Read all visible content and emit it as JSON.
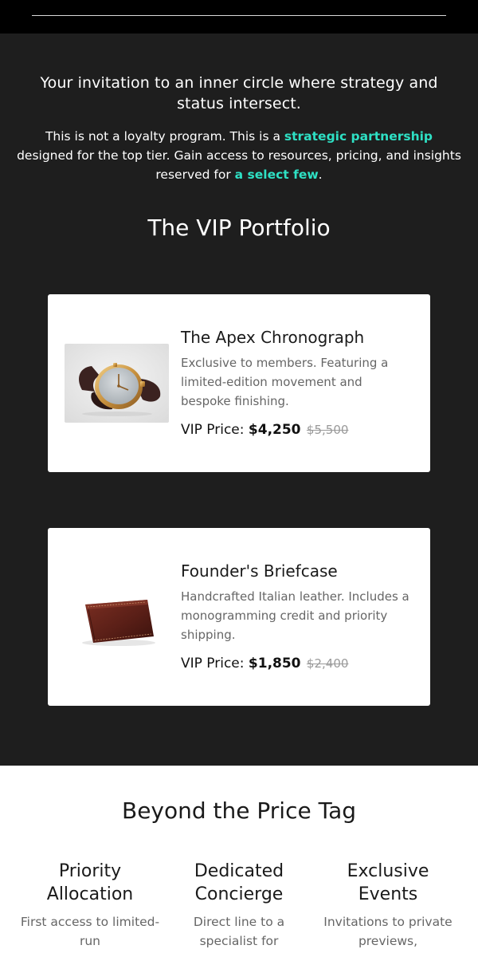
{
  "intro": {
    "title": "Your invitation to an inner circle where strategy and status intersect.",
    "body_part1": "This is not a loyalty program. This is a ",
    "highlight1": "strategic partnership",
    "body_part2": " designed for the top tier. Gain access to resources, pricing, and insights reserved for ",
    "highlight2": "a select few",
    "body_part3": "."
  },
  "portfolio": {
    "title": "The VIP Portfolio",
    "products": [
      {
        "name": "The Apex Chronograph",
        "description": "Exclusive to members. Featuring a limited-edition movement and bespoke finishing.",
        "price_label": "VIP Price:",
        "price": "$4,250",
        "original_price": "$5,500",
        "image": "watch-image"
      },
      {
        "name": "Founder's Briefcase",
        "description": "Handcrafted Italian leather. Includes a monogramming credit and priority shipping.",
        "price_label": "VIP Price:",
        "price": "$1,850",
        "original_price": "$2,400",
        "image": "leather-wallet-image"
      }
    ]
  },
  "beyond": {
    "title": "Beyond the Price Tag",
    "benefits": [
      {
        "title": "Priority Allocation",
        "description": "First access to limited-run"
      },
      {
        "title": "Dedicated Concierge",
        "description": "Direct line to a specialist for"
      },
      {
        "title": "Exclusive Events",
        "description": "Invitations to private previews,"
      }
    ]
  },
  "colors": {
    "accent": "#2ee0c4",
    "dark_background": "#1e1e1e",
    "header_background": "#000000"
  }
}
